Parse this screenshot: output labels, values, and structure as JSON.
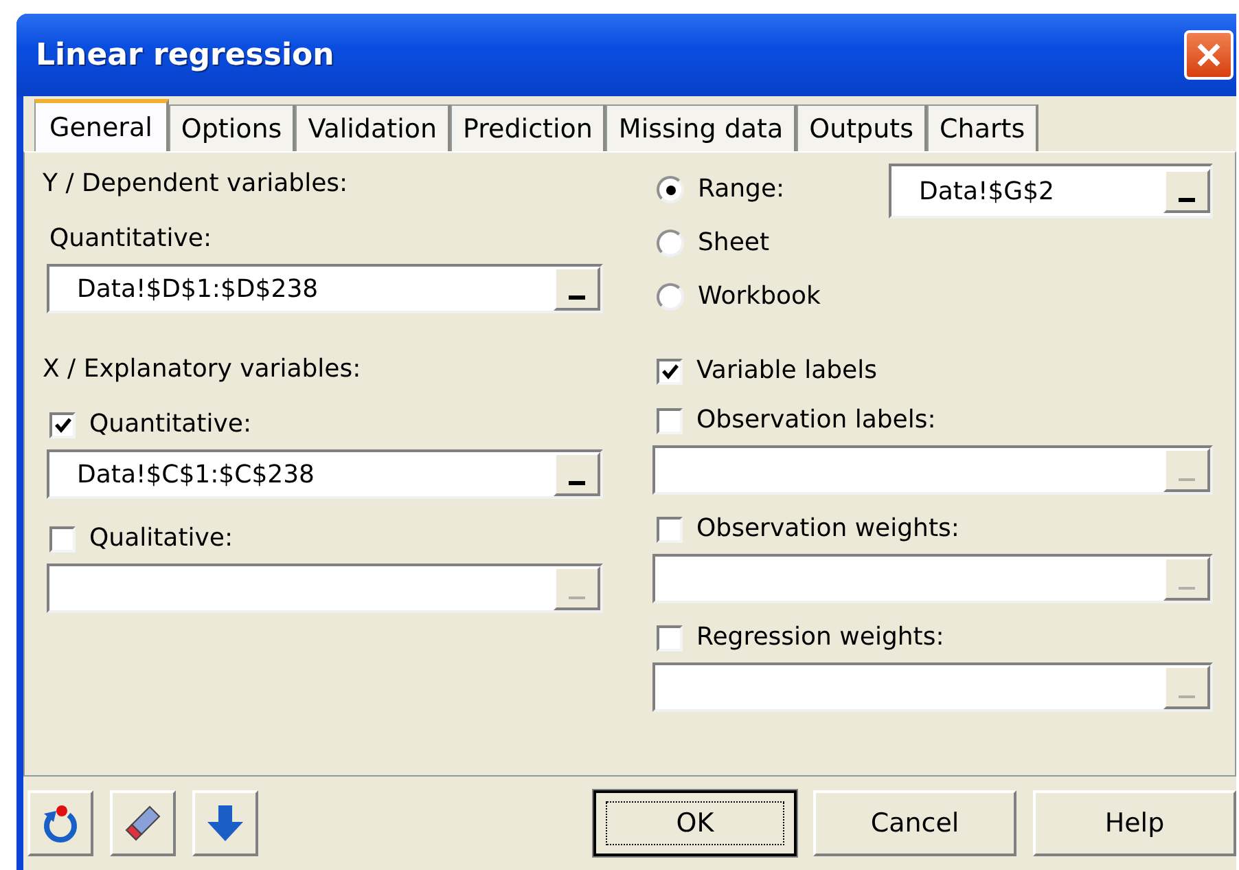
{
  "window": {
    "title": "Linear regression"
  },
  "tabs": [
    {
      "label": "General",
      "selected": true
    },
    {
      "label": "Options",
      "selected": false
    },
    {
      "label": "Validation",
      "selected": false
    },
    {
      "label": "Prediction",
      "selected": false
    },
    {
      "label": "Missing data",
      "selected": false
    },
    {
      "label": "Outputs",
      "selected": false
    },
    {
      "label": "Charts",
      "selected": false
    }
  ],
  "dependent": {
    "heading": "Y / Dependent variables:",
    "label": "Quantitative:",
    "field": {
      "value": "Data!$D$1:$D$238",
      "disabled": false
    }
  },
  "explanatory": {
    "heading": "X / Explanatory variables:",
    "options": [
      {
        "label": "Quantitative:",
        "checked": true,
        "field": {
          "value": "Data!$C$1:$C$238",
          "disabled": false
        }
      },
      {
        "label": "Qualitative:",
        "checked": false,
        "field": {
          "disabled": true
        }
      }
    ]
  },
  "scope": [
    {
      "label": "Range:",
      "selected": true
    },
    {
      "label": "Sheet",
      "selected": false
    },
    {
      "label": "Workbook",
      "selected": false
    }
  ],
  "range_field": {
    "value": "Data!$G$2",
    "disabled": false
  },
  "options": [
    {
      "label": "Variable labels",
      "checked": true
    },
    {
      "label": "Observation labels:",
      "checked": false,
      "field": {
        "disabled": true
      }
    },
    {
      "label": "Observation weights:",
      "checked": false,
      "field": {
        "disabled": true
      }
    },
    {
      "label": "Regression weights:",
      "checked": false,
      "field": {
        "disabled": true
      }
    }
  ],
  "buttons": [
    {
      "label": "OK",
      "default": true
    },
    {
      "label": "Cancel",
      "default": false
    },
    {
      "label": "Help",
      "default": false
    }
  ]
}
